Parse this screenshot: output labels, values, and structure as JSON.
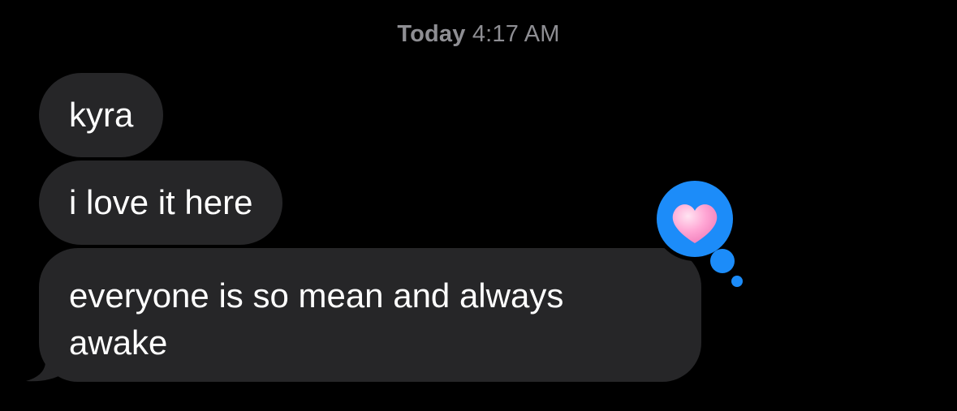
{
  "timestamp": {
    "day": "Today",
    "time": "4:17 AM"
  },
  "messages": [
    {
      "text": "kyra"
    },
    {
      "text": "i love it here"
    },
    {
      "text": "everyone is so mean and always awake"
    }
  ],
  "tapback": {
    "icon": "heart-icon",
    "bubble_color": "#1c8cf9",
    "heart_color": "#ff9fd0"
  },
  "colors": {
    "background": "#000000",
    "incoming_bubble": "#262628",
    "timestamp_text": "#8e8e93"
  }
}
